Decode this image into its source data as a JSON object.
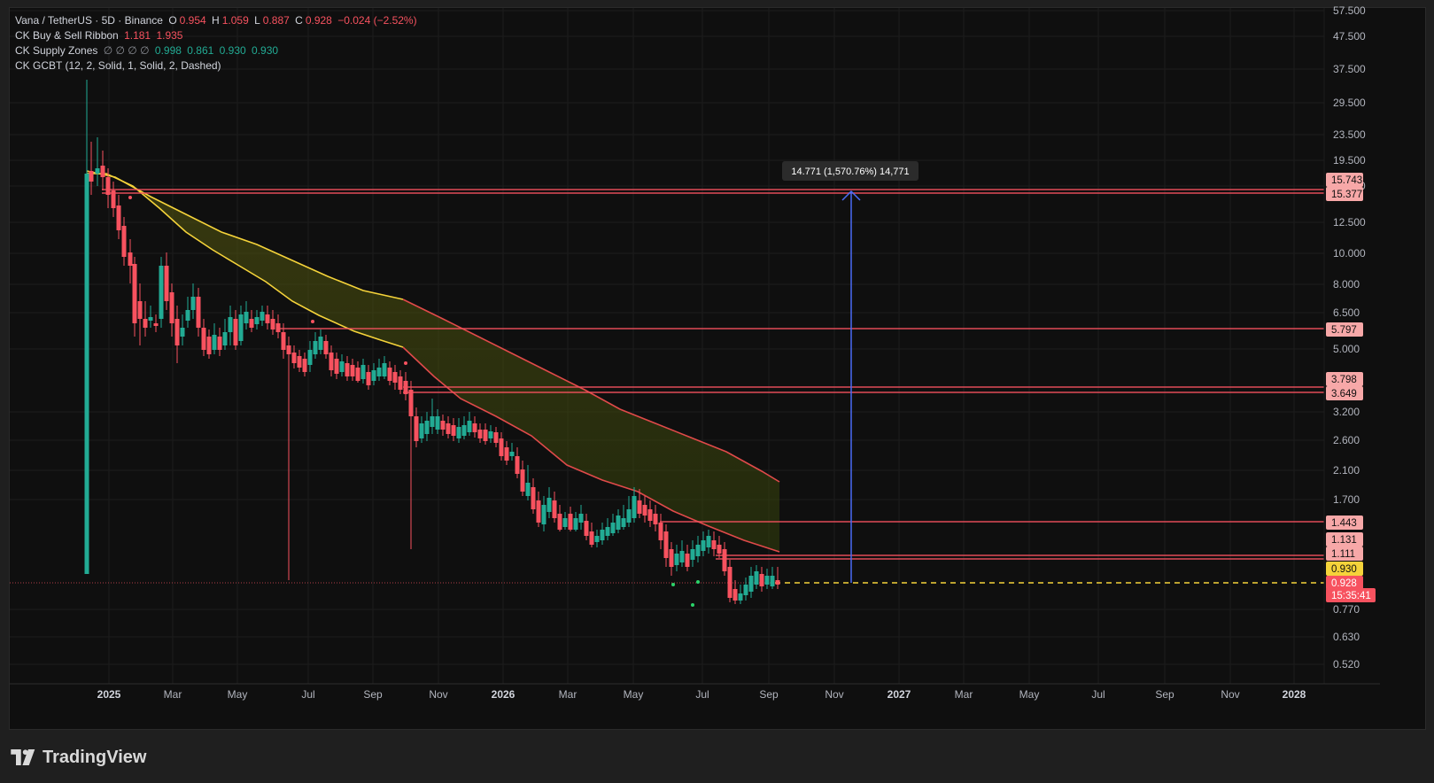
{
  "legend": {
    "symbol": "Vana / TetherUS · 5D · Binance",
    "o_label": "O",
    "o_val": "0.954",
    "h_label": "H",
    "h_val": "1.059",
    "l_label": "L",
    "l_val": "0.887",
    "c_label": "C",
    "c_val": "0.928",
    "change": "−0.024 (−2.52%)",
    "ind1_name": "CK Buy & Sell Ribbon",
    "ind1_v1": "1.181",
    "ind1_v2": "1.935",
    "ind2_name": "CK Supply Zones",
    "ind2_empty": "∅  ∅  ∅  ∅",
    "ind2_v1": "0.998",
    "ind2_v2": "0.861",
    "ind2_v3": "0.930",
    "ind2_v4": "0.930",
    "ind3_name": "CK GCBT (12, 2, Solid, 1, Solid, 2, Dashed)"
  },
  "price_axis": [
    "57.500",
    "47.500",
    "37.500",
    "29.500",
    "23.500",
    "19.500",
    "15.500",
    "12.500",
    "10.000",
    "8.000",
    "6.500",
    "5.000",
    "3.200",
    "2.600",
    "2.100",
    "1.700",
    "0.770",
    "0.630",
    "0.520"
  ],
  "price_axis_y": [
    0.12,
    0.033,
    0.047,
    0.1,
    0.0
  ],
  "price_badges": [
    {
      "label": "15.743",
      "kind": "zone"
    },
    {
      "label": "15.377",
      "kind": "zone"
    },
    {
      "label": "5.797",
      "kind": "zone"
    },
    {
      "label": "3.798",
      "kind": "zone"
    },
    {
      "label": "3.649",
      "kind": "zone"
    },
    {
      "label": "1.443",
      "kind": "zone"
    },
    {
      "label": "1.131",
      "kind": "zone"
    },
    {
      "label": "1.111",
      "kind": "zone"
    },
    {
      "label": "0.930",
      "kind": "ribbon"
    },
    {
      "label": "0.928",
      "kind": "last"
    },
    {
      "label": "15:35:41",
      "kind": "countdown"
    }
  ],
  "time_axis": [
    "2025",
    "Mar",
    "May",
    "Jul",
    "Sep",
    "Nov",
    "2026",
    "Mar",
    "May",
    "Jul",
    "Sep",
    "Nov",
    "2027",
    "Mar",
    "May",
    "Jul",
    "Sep",
    "Nov",
    "2028"
  ],
  "measure_label": "14.771 (1,570.76%) 14,771",
  "brand": "TradingView",
  "colors": {
    "up": "#22ab94",
    "down": "#f7525f",
    "zone": "#f7525f",
    "ribbon_fast": "#f5d33a",
    "ribbon_slow": "#e04a4a",
    "measure": "#4a6cf7",
    "background": "#0f0f0f"
  }
}
